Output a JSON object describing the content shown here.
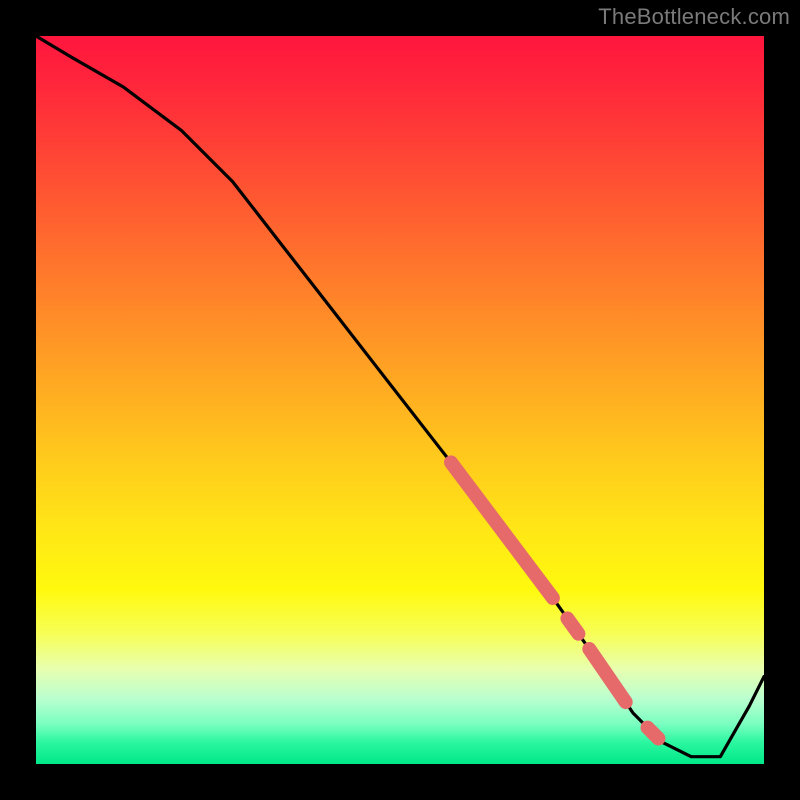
{
  "watermark": "TheBottleneck.com",
  "chart_data": {
    "type": "line",
    "title": "",
    "xlabel": "",
    "ylabel": "",
    "xlim": [
      0,
      100
    ],
    "ylim": [
      0,
      100
    ],
    "grid": false,
    "legend": false,
    "series": [
      {
        "name": "bottleneck-curve",
        "x": [
          0,
          5,
          12,
          20,
          27,
          34,
          41,
          48,
          55,
          62,
          68,
          73,
          78,
          82,
          86,
          90,
          94,
          98,
          100
        ],
        "y": [
          100,
          97,
          93,
          87,
          80,
          71,
          62,
          53,
          44,
          35,
          27,
          20,
          13,
          7,
          3,
          1,
          1,
          8,
          12
        ]
      }
    ],
    "highlights": [
      {
        "name": "segment-upper",
        "x_start": 57,
        "x_end": 71,
        "thick": true
      },
      {
        "name": "dot-mid",
        "x_start": 73,
        "x_end": 74.5,
        "thick": true
      },
      {
        "name": "segment-lower",
        "x_start": 76,
        "x_end": 81,
        "thick": true
      },
      {
        "name": "dot-low",
        "x_start": 84,
        "x_end": 85.5,
        "thick": true
      }
    ],
    "colors": {
      "line": "#000000",
      "highlight": "#e66a6a",
      "gradient_top": "#ff163e",
      "gradient_bottom": "#00e888"
    }
  }
}
